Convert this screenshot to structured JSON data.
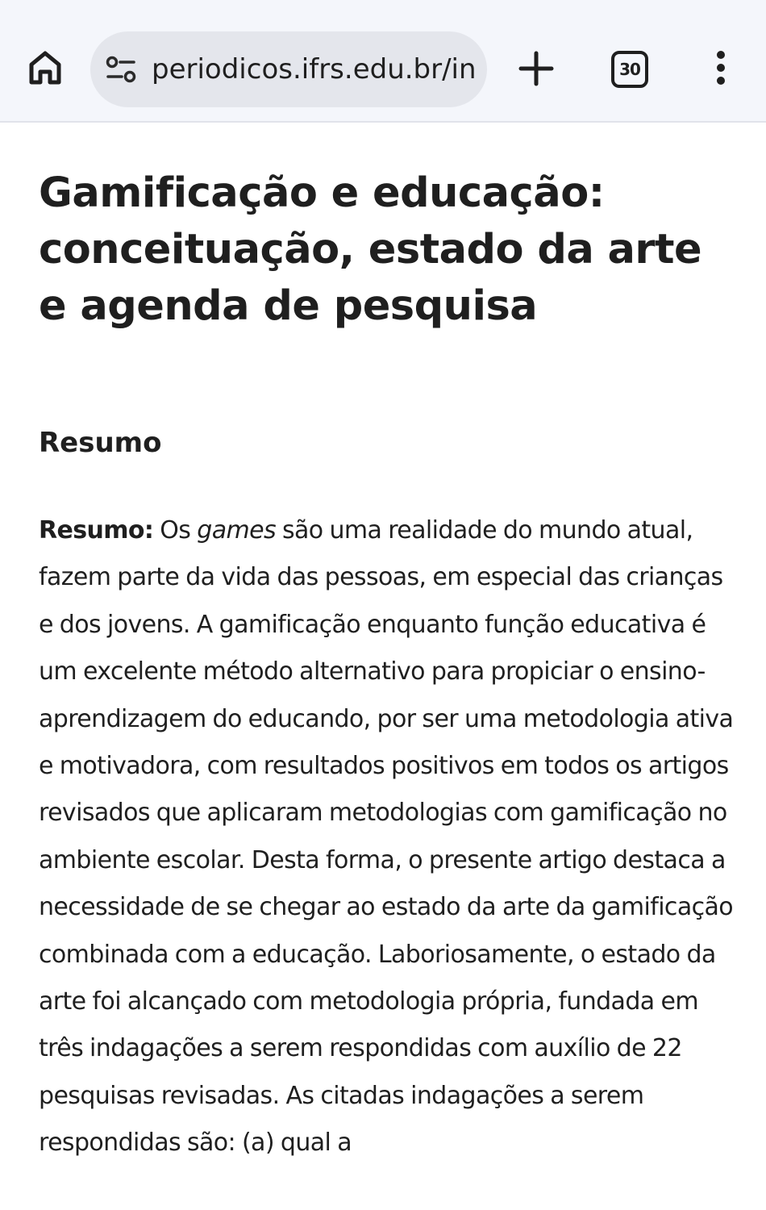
{
  "browser": {
    "url": "periodicos.ifrs.edu.br/in",
    "tab_count": "30",
    "icons": {
      "home": "home-icon",
      "site_info": "tune-icon",
      "new_tab": "plus-icon",
      "tabs": "tab-switcher-icon",
      "menu": "more-vertical-icon"
    }
  },
  "article": {
    "title": "Gamificação e educação: conceituação, estado da arte e agenda de pesquisa",
    "section_heading": "Resumo",
    "abstract": {
      "label": "Resumo:",
      "text_start": " Os ",
      "emphasis": "games",
      "text_rest": " são uma realidade do mundo atual, fazem parte da vida das pessoas, em especial das crianças e dos jovens. A gamificação enquanto função educativa é um excelente método alternativo para propiciar o ensino-aprendizagem do educando, por ser uma metodologia ativa e motivadora, com resultados positivos em todos os artigos revisados que aplicaram metodologias com gamificação no ambiente escolar. Desta forma, o presente artigo destaca a necessidade de se chegar ao estado da arte da gamificação combinada com a educação. Laboriosamente, o estado da arte foi alcançado com metodologia própria, fundada em três indagações a serem respondidas com auxílio de 22 pesquisas revisadas. As citadas indagações a serem respondidas são: (a) qual a"
    }
  }
}
